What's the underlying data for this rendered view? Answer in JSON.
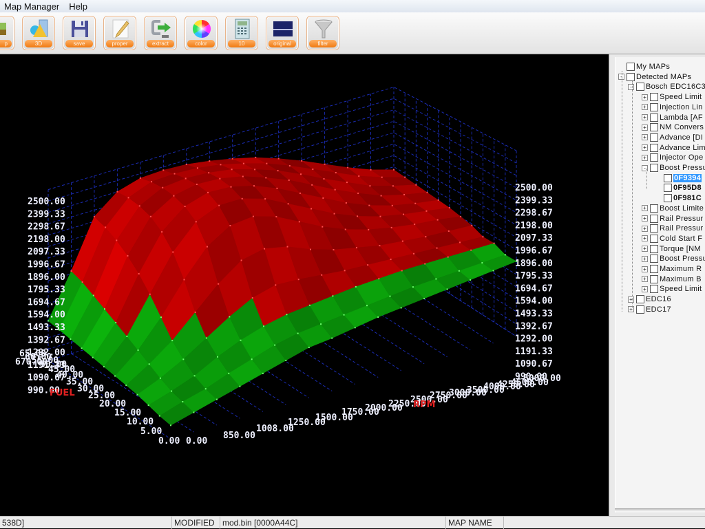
{
  "menu": {
    "items": [
      "Map Manager",
      "Help"
    ]
  },
  "toolbar": {
    "buttons": [
      {
        "id": "map",
        "label": "p",
        "icon": "map-icon"
      },
      {
        "id": "3d",
        "label": "3D",
        "icon": "3d-shapes-icon"
      },
      {
        "id": "save",
        "label": "save",
        "icon": "floppy-disk-icon"
      },
      {
        "id": "proper",
        "label": "proper",
        "icon": "pencil-paper-icon"
      },
      {
        "id": "extract",
        "label": "extract",
        "icon": "extract-arrow-icon"
      },
      {
        "id": "color",
        "label": "color",
        "icon": "color-wheel-icon"
      },
      {
        "id": "calc",
        "label": "10",
        "icon": "calculator-icon"
      },
      {
        "id": "original",
        "label": "original",
        "icon": "original-graph-icon"
      },
      {
        "id": "filter",
        "label": "filter",
        "icon": "funnel-icon"
      }
    ]
  },
  "chart_data": {
    "type": "surface3d",
    "title": "",
    "z_ticks": [
      "2500.00",
      "2399.33",
      "2298.67",
      "2198.00",
      "2097.33",
      "1996.67",
      "1896.00",
      "1795.33",
      "1694.67",
      "1594.00",
      "1493.33",
      "1392.67",
      "1292.00",
      "1191.33",
      "1090.67",
      "990.00"
    ],
    "zlim": [
      990,
      2500
    ],
    "x_label": "RPM",
    "x_ticks": [
      "0.00",
      "850.00",
      "1008.00",
      "1250.00",
      "1500.00",
      "1750.00",
      "2000.00",
      "2250.00",
      "2500.00",
      "2750.00",
      "3000.00",
      "3500.00",
      "4000.00",
      "4250.00",
      "4500.00",
      "5000.00"
    ],
    "y_label": "FUEL",
    "y_ticks": [
      "0.00",
      "5.00",
      "10.00",
      "15.00",
      "20.00",
      "25.00",
      "30.00",
      "35.00",
      "40.00",
      "45.00",
      "50.00",
      "55.00",
      "60.00",
      "65.00",
      "670.00"
    ],
    "threshold_colors": {
      "above": "#b00000",
      "below": "#0a9a0a"
    },
    "grid_color": "#1a2bb0",
    "rows": [
      [
        1100,
        1150,
        1200,
        1250,
        1300,
        1350,
        1400,
        1420,
        1450,
        1480,
        1500,
        1520,
        1540,
        1560,
        1580,
        1600
      ],
      [
        1120,
        1180,
        1230,
        1300,
        1360,
        1420,
        1460,
        1480,
        1500,
        1520,
        1540,
        1560,
        1570,
        1580,
        1590,
        1600
      ],
      [
        1150,
        1210,
        1280,
        1380,
        1460,
        1520,
        1560,
        1580,
        1600,
        1620,
        1630,
        1640,
        1640,
        1640,
        1640,
        1640
      ],
      [
        1180,
        1260,
        1360,
        1480,
        1600,
        1700,
        1750,
        1740,
        1720,
        1700,
        1690,
        1680,
        1670,
        1660,
        1650,
        1640
      ],
      [
        1200,
        1320,
        1460,
        1640,
        1820,
        1960,
        2000,
        1960,
        1880,
        1820,
        1780,
        1740,
        1720,
        1700,
        1690,
        1680
      ],
      [
        1220,
        1380,
        1600,
        1860,
        2080,
        2200,
        2220,
        2160,
        2060,
        1960,
        1880,
        1820,
        1780,
        1750,
        1730,
        1700
      ],
      [
        1240,
        1440,
        1740,
        2040,
        2240,
        2320,
        2320,
        2260,
        2160,
        2060,
        1960,
        1880,
        1820,
        1780,
        1750,
        1720
      ],
      [
        1260,
        1500,
        1860,
        2160,
        2320,
        2380,
        2370,
        2320,
        2240,
        2140,
        2040,
        1940,
        1860,
        1800,
        1760,
        1730
      ],
      [
        1280,
        1560,
        1960,
        2240,
        2360,
        2400,
        2390,
        2350,
        2280,
        2200,
        2100,
        2000,
        1910,
        1830,
        1780,
        1740
      ],
      [
        1300,
        1620,
        2040,
        2280,
        2380,
        2400,
        2390,
        2360,
        2300,
        2230,
        2140,
        2040,
        1950,
        1860,
        1800,
        1750
      ],
      [
        1320,
        1680,
        2100,
        2300,
        2380,
        2390,
        2380,
        2350,
        2300,
        2240,
        2160,
        2070,
        1980,
        1890,
        1820,
        1760
      ],
      [
        1340,
        1720,
        2140,
        2300,
        2360,
        2370,
        2360,
        2330,
        2290,
        2240,
        2170,
        2090,
        2000,
        1910,
        1830,
        1770
      ]
    ]
  },
  "tree": {
    "nodes": [
      {
        "label": "My MAPs",
        "level": 0,
        "expander": "",
        "style": ""
      },
      {
        "label": "Detected MAPs",
        "level": 0,
        "expander": "-",
        "style": ""
      },
      {
        "label": "Bosch EDC16C3",
        "level": 1,
        "expander": "-",
        "style": ""
      },
      {
        "label": "Speed Limit",
        "level": 2,
        "expander": "+",
        "style": ""
      },
      {
        "label": "Injection Lin",
        "level": 2,
        "expander": "+",
        "style": ""
      },
      {
        "label": "Lambda [AF",
        "level": 2,
        "expander": "+",
        "style": ""
      },
      {
        "label": "NM Convers",
        "level": 2,
        "expander": "+",
        "style": ""
      },
      {
        "label": "Advance [DI",
        "level": 2,
        "expander": "+",
        "style": ""
      },
      {
        "label": "Advance Lim",
        "level": 2,
        "expander": "+",
        "style": ""
      },
      {
        "label": "Injector Ope",
        "level": 2,
        "expander": "+",
        "style": ""
      },
      {
        "label": "Boost Pressu",
        "level": 2,
        "expander": "-",
        "style": ""
      },
      {
        "label": "0F9394",
        "level": 3,
        "expander": "",
        "style": "selected"
      },
      {
        "label": "0F95D8",
        "level": 3,
        "expander": "",
        "style": "bold"
      },
      {
        "label": "0F981C",
        "level": 3,
        "expander": "",
        "style": "bold"
      },
      {
        "label": "Boost Limite",
        "level": 2,
        "expander": "+",
        "style": ""
      },
      {
        "label": "Rail Pressur",
        "level": 2,
        "expander": "+",
        "style": ""
      },
      {
        "label": "Rail Pressur",
        "level": 2,
        "expander": "+",
        "style": ""
      },
      {
        "label": "Cold Start F",
        "level": 2,
        "expander": "+",
        "style": ""
      },
      {
        "label": "Torque [NM",
        "level": 2,
        "expander": "+",
        "style": ""
      },
      {
        "label": "Boost Pressu",
        "level": 2,
        "expander": "+",
        "style": ""
      },
      {
        "label": "Maximum R",
        "level": 2,
        "expander": "+",
        "style": ""
      },
      {
        "label": "Maximum B",
        "level": 2,
        "expander": "+",
        "style": ""
      },
      {
        "label": "Speed Limit",
        "level": 2,
        "expander": "+",
        "style": ""
      },
      {
        "label": "EDC16",
        "level": 1,
        "expander": "+",
        "style": ""
      },
      {
        "label": "EDC17",
        "level": 1,
        "expander": "+",
        "style": ""
      }
    ]
  },
  "status": {
    "address": "538D]",
    "state": "MODIFIED",
    "file": "mod.bin [0000A44C]",
    "map_name": "MAP NAME"
  }
}
